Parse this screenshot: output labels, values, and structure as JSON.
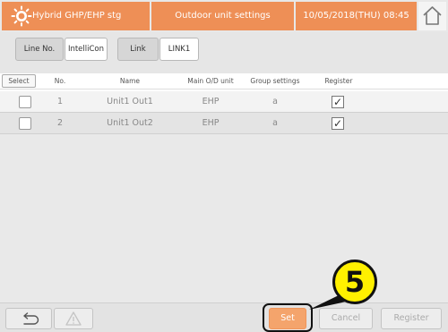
{
  "titlebar": {
    "app_name": "Hybrid GHP/EHP stg",
    "screen_title": "Outdoor unit settings",
    "datetime": "10/05/2018(THU) 08:45"
  },
  "filters": {
    "line_no_label": "Line No.",
    "line_no_value": "IntelliCon",
    "link_label": "Link",
    "link_value": "LINK1"
  },
  "table": {
    "columns": [
      "Select",
      "No.",
      "Name",
      "Main O/D unit",
      "Group settings",
      "Register"
    ],
    "rows": [
      {
        "no": "1",
        "name": "Unit1 Out1",
        "main_od_unit": "EHP",
        "group_settings": "a",
        "register": "✓"
      },
      {
        "no": "2",
        "name": "Unit1 Out2",
        "main_od_unit": "EHP",
        "group_settings": "a",
        "register": "✓"
      }
    ]
  },
  "bottom": {
    "back_icon": "⮌",
    "warning_icon": "⚠",
    "set_label": "Set",
    "cancel_label": "Cancel",
    "register_label": "Register"
  },
  "callout": {
    "number": "5"
  },
  "colors": {
    "accent": "#ee8f56",
    "set_button": "#f4a46c",
    "callout": "#fff000"
  },
  "icons": [
    "sun-icon",
    "home-icon",
    "back-arrow-icon",
    "warning-icon",
    "check-icon"
  ]
}
